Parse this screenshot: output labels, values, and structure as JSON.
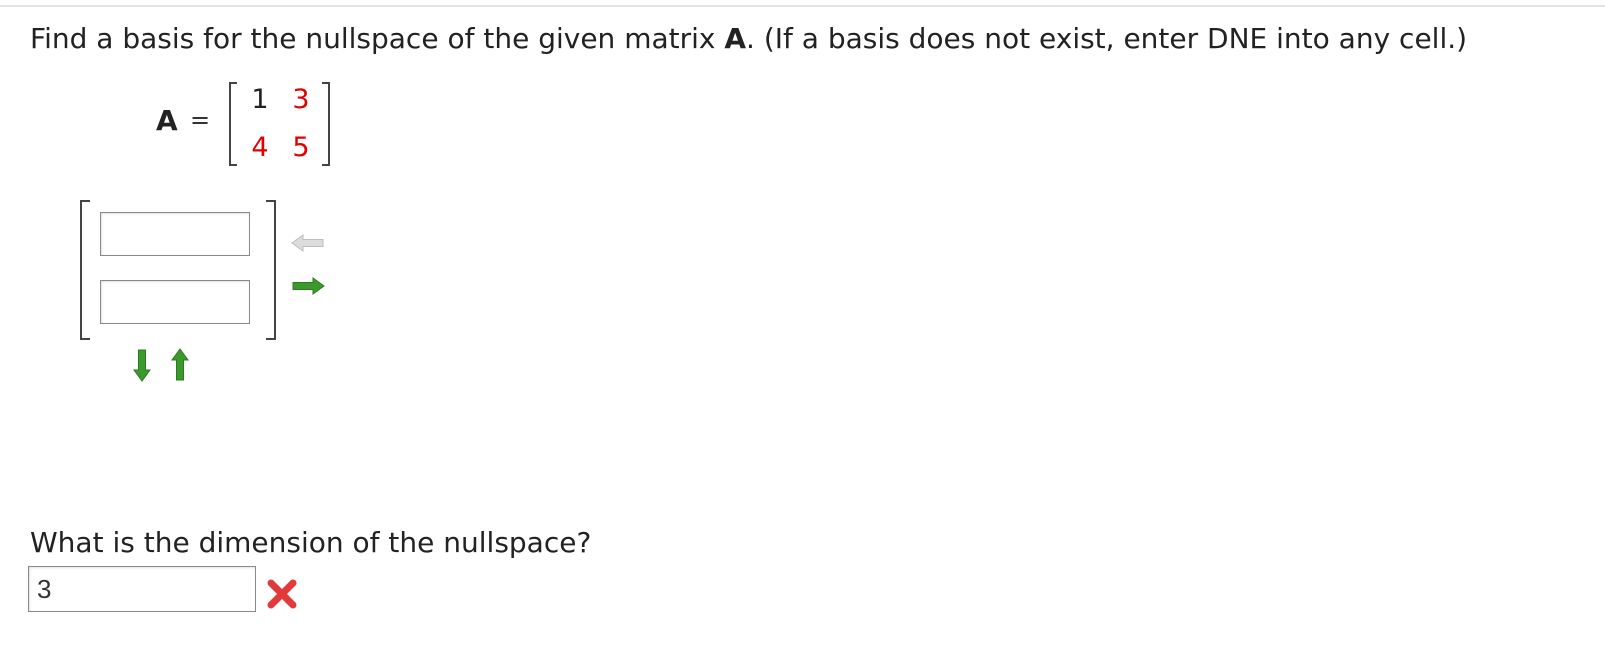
{
  "question": {
    "prefix": "Find a basis for the nullspace of the given matrix ",
    "bold": "A",
    "suffix": ". (If a basis does not exist, enter DNE into any cell.)"
  },
  "matrix": {
    "label": "A",
    "equals": "=",
    "rows": [
      [
        "1",
        "3"
      ],
      [
        "4",
        "5"
      ]
    ],
    "entry_colors": [
      [
        "#222222",
        "#e00000"
      ],
      [
        "#e00000",
        "#e00000"
      ]
    ]
  },
  "basis_vector": {
    "cells": [
      "",
      ""
    ]
  },
  "icons": {
    "remove_column": "left-arrow-icon",
    "add_column": "right-arrow-icon",
    "add_row": "down-arrow-icon",
    "remove_row": "up-arrow-icon",
    "incorrect": "red-x-icon"
  },
  "dimension": {
    "question": "What is the dimension of the nullspace?",
    "value": "3",
    "status": "incorrect"
  },
  "colors": {
    "accent_green": "#3c9a2d",
    "disabled_gray": "#c8c8c8",
    "error_red": "#e23a3a",
    "matrix_entry_red": "#e00000"
  }
}
